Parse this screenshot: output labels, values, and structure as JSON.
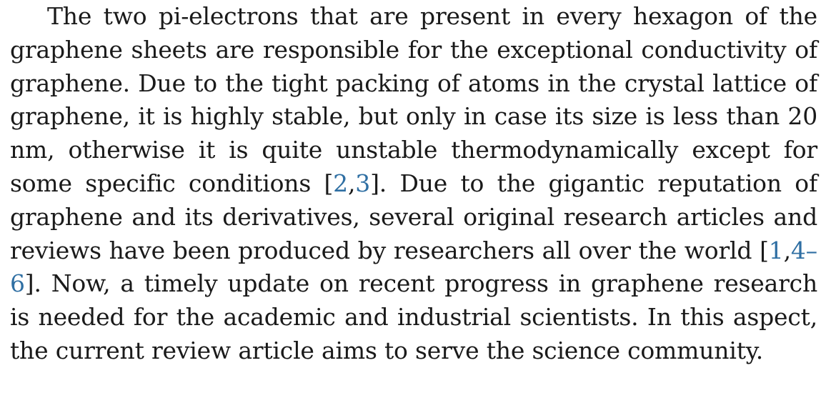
{
  "paragraph": {
    "part1": "The two pi-electrons that are present in every hexagon of the graphene sheets are responsible for the exceptional conductivity of graphene. Due to the tight packing of atoms in the crystal lattice of graphene, it is highly stable, but only in case its size is less than 20 nm, otherwise it is quite unstable thermodynamically except for some specific conditions [",
    "ref_2": "2",
    "comma_1": ",",
    "ref_3": "3",
    "part2": "]. Due to the gigantic reputation of graphene and its derivatives, several original research articles and reviews have been produced by researchers all over the world [",
    "ref_1": "1",
    "comma_2": ",",
    "ref_4_6": "4–6",
    "part3": "]. Now, a timely update on recent progress in graphene research is needed for the academic and industrial scientists. In this aspect, the current review article aims to serve the science community."
  },
  "colors": {
    "text": "#1a1a1a",
    "reference_link": "#2f6fa3"
  }
}
